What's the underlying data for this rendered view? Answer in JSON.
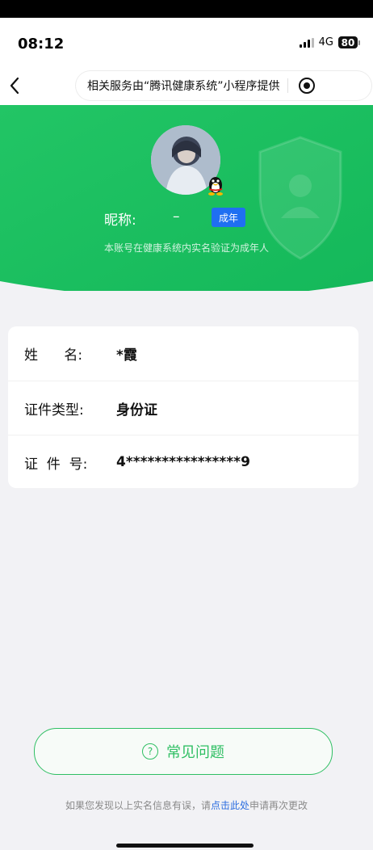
{
  "status_bar": {
    "time": "08:12",
    "network": "4G",
    "battery": "80"
  },
  "nav": {
    "provider_text": "相关服务由“腾讯健康系统”小程序提供"
  },
  "profile": {
    "nickname_label": "昵称:",
    "nickname_value": "–",
    "adult_badge": "成年",
    "verification_note": "本账号在健康系统内实名验证为成年人"
  },
  "identity": {
    "rows": [
      {
        "label": "姓      名:",
        "value": "*霞"
      },
      {
        "label": "证件类型:",
        "value": "身份证"
      },
      {
        "label": "证  件  号:",
        "value": "4****************9"
      }
    ]
  },
  "faq": {
    "label": "常见问题"
  },
  "footer": {
    "prefix": "如果您发现以上实名信息有误，请",
    "link": "点击此处",
    "suffix": "申请再次更改"
  },
  "colors": {
    "brand_green": "#2fbf63",
    "badge_blue": "#1f6ff2",
    "link_blue": "#2b6de0"
  }
}
